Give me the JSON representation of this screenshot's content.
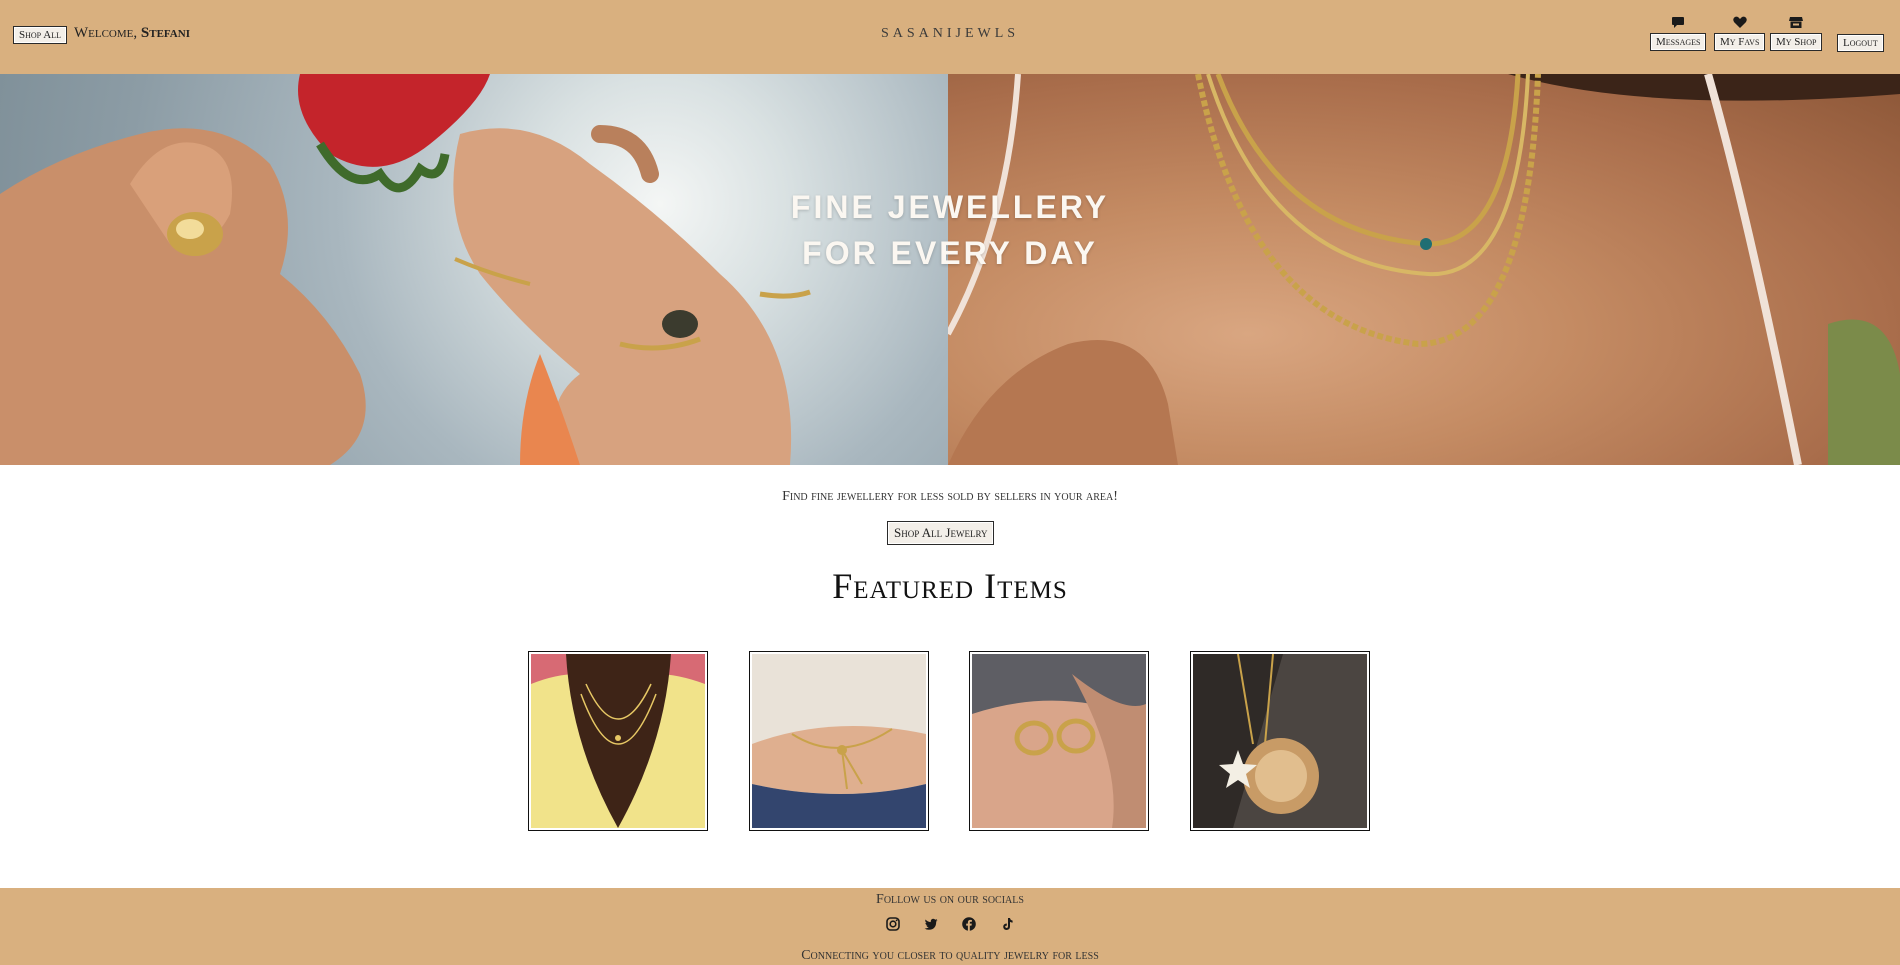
{
  "header": {
    "shop_all_label": "Shop All",
    "welcome_prefix": "Welcome,",
    "user_name": "Stefani",
    "brand": "SASANIJEWLS",
    "nav": {
      "messages_label": "Messages",
      "favs_label": "My Favs",
      "shop_label": "My Shop",
      "logout_label": "Logout"
    },
    "icons": [
      "message-icon",
      "heart-icon",
      "store-icon"
    ]
  },
  "hero": {
    "line1": "FINE JEWELLERY",
    "line2": "FOR EVERY DAY"
  },
  "intro": {
    "tagline": "Find fine jewellery for less sold by sellers in your area!",
    "shop_all_jewelry_label": "Shop All Jewelry"
  },
  "featured": {
    "title": "Featured Items"
  },
  "footer": {
    "follow_text": "Follow us on our socials",
    "socials": [
      "instagram-icon",
      "twitter-icon",
      "facebook-icon",
      "tiktok-icon"
    ],
    "connect_text": "Connecting you closer to quality jewelry for less"
  },
  "colors": {
    "bar": "#d9b07f",
    "accent_gold": "#c9a24a"
  }
}
